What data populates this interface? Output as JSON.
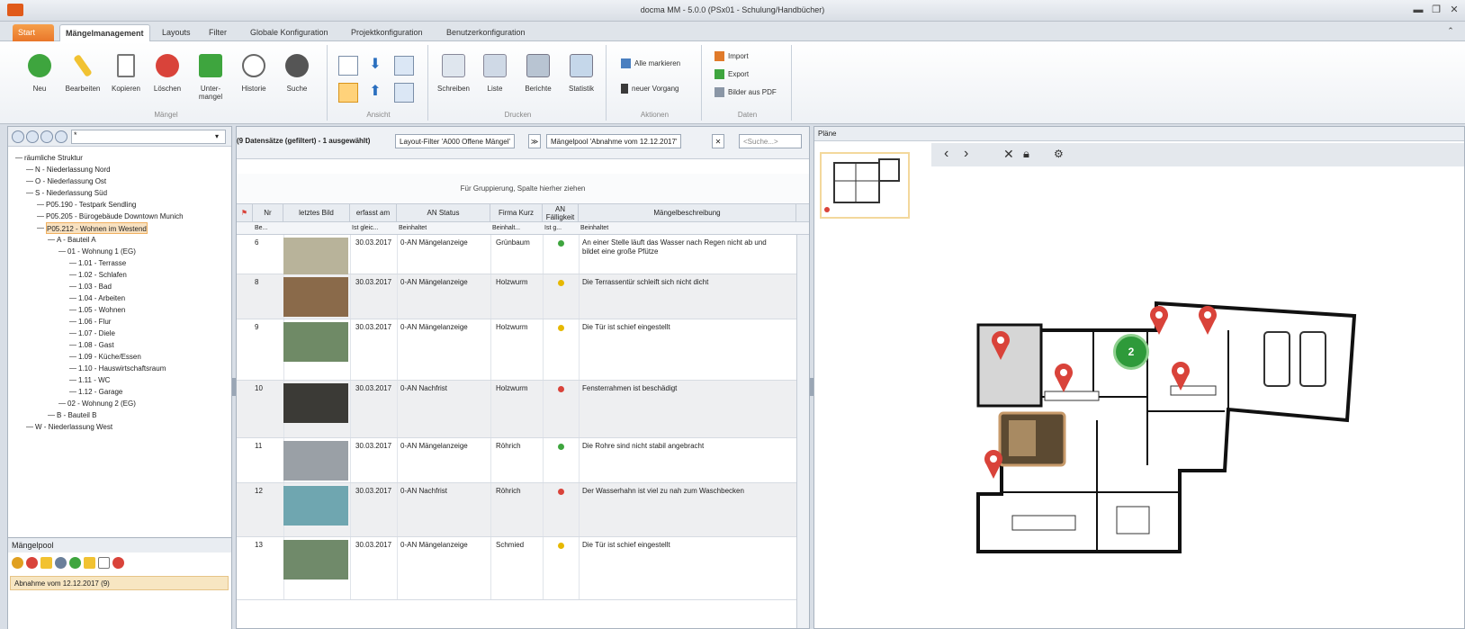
{
  "window": {
    "title": "docma MM - 5.0.0 (PSx01 - Schulung/Handbücher)"
  },
  "tabs": [
    "Start",
    "Mängelmanagement",
    "Layouts",
    "Filter",
    "Globale Konfiguration",
    "Projektkonfiguration",
    "Benutzerkonfiguration"
  ],
  "ribbon": {
    "maengel": {
      "buttons": [
        "Neu",
        "Bearbeiten",
        "Kopieren",
        "Löschen",
        "Unter-\nmangel",
        "Historie",
        "Suche"
      ],
      "label": "Mängel"
    },
    "ansicht": {
      "label": "Ansicht"
    },
    "drucken": {
      "buttons": [
        "Schreiben",
        "Liste",
        "Berichte",
        "Statistik"
      ],
      "label": "Drucken"
    },
    "aktionen": {
      "items": [
        "Alle markieren",
        "neuer Vorgang"
      ],
      "label": "Aktionen"
    },
    "daten": {
      "items": [
        "Import",
        "Export",
        "Bilder aus PDF"
      ],
      "label": "Daten"
    }
  },
  "left_toolbar": {
    "filter_value": "*"
  },
  "tree": [
    {
      "label": "räumliche Struktur",
      "level": 0
    },
    {
      "label": "N - Niederlassung Nord",
      "level": 1
    },
    {
      "label": "O - Niederlassung Ost",
      "level": 1
    },
    {
      "label": "S - Niederlassung Süd",
      "level": 1
    },
    {
      "label": "P05.190 - Testpark Sendling",
      "level": 2
    },
    {
      "label": "P05.205 - Bürogebäude Downtown Munich",
      "level": 2
    },
    {
      "label": "P05.212 - Wohnen im Westend",
      "level": 2,
      "selected": true
    },
    {
      "label": "A - Bauteil A",
      "level": 3
    },
    {
      "label": "01 - Wohnung 1 (EG)",
      "level": 4
    },
    {
      "label": "1.01 - Terrasse",
      "level": 5
    },
    {
      "label": "1.02 - Schlafen",
      "level": 5
    },
    {
      "label": "1.03 - Bad",
      "level": 5
    },
    {
      "label": "1.04 - Arbeiten",
      "level": 5
    },
    {
      "label": "1.05 - Wohnen",
      "level": 5
    },
    {
      "label": "1.06 - Flur",
      "level": 5
    },
    {
      "label": "1.07 - Diele",
      "level": 5
    },
    {
      "label": "1.08 - Gast",
      "level": 5
    },
    {
      "label": "1.09 - Küche/Essen",
      "level": 5
    },
    {
      "label": "1.10 - Hauswirtschaftsraum",
      "level": 5
    },
    {
      "label": "1.11 - WC",
      "level": 5
    },
    {
      "label": "1.12 - Garage",
      "level": 5
    },
    {
      "label": "02 - Wohnung 2 (EG)",
      "level": 4
    },
    {
      "label": "B - Bauteil B",
      "level": 3
    },
    {
      "label": "W - Niederlassung West",
      "level": 1
    }
  ],
  "maengelpool": {
    "title": "Mängelpool",
    "selected": "Abnahme vom 12.12.2017 (9)"
  },
  "middle": {
    "count": "(9 Datensätze (gefiltert) - 1 ausgewählt)",
    "layout_filter": "Layout-Filter 'A000 Offene Mängel'",
    "pool_filter": "Mängelpool 'Abnahme vom 12.12.2017'",
    "search_placeholder": "<Suche...>",
    "group_hint": "Für Gruppierung, Spalte hierher ziehen",
    "columns": [
      "Nr",
      "letztes Bild",
      "erfasst am",
      "AN Status",
      "Firma Kurz",
      "AN Fälligkeit",
      "Mängelbeschreibung"
    ],
    "filters": [
      "Be...",
      "Ist gleic...",
      "Beinhaltet",
      "Beinhalt...",
      "Ist g...",
      "Beinhaltet"
    ],
    "rows": [
      {
        "nr": "6",
        "date": "30.03.2017",
        "status": "0-AN Mängelanzeige",
        "firma": "Grünbaum",
        "due": "green",
        "desc": "An einer Stelle läuft das Wasser nach Regen nicht ab und\nbildet eine große Pfütze"
      },
      {
        "nr": "8",
        "date": "30.03.2017",
        "status": "0-AN Mängelanzeige",
        "firma": "Holzwurm",
        "due": "yellow",
        "desc": "Die Terrassentür schleift sich nicht dicht"
      },
      {
        "nr": "9",
        "date": "30.03.2017",
        "status": "0-AN Mängelanzeige",
        "firma": "Holzwurm",
        "due": "yellow",
        "desc": "Die Tür ist schief eingestellt"
      },
      {
        "nr": "10",
        "date": "30.03.2017",
        "status": "0-AN Nachfrist",
        "firma": "Holzwurm",
        "due": "red",
        "desc": "Fensterrahmen ist beschädigt"
      },
      {
        "nr": "11",
        "date": "30.03.2017",
        "status": "0-AN Mängelanzeige",
        "firma": "Röhrich",
        "due": "green",
        "desc": "Die Rohre sind nicht stabil angebracht"
      },
      {
        "nr": "12",
        "date": "30.03.2017",
        "status": "0-AN Nachfrist",
        "firma": "Röhrich",
        "due": "red",
        "desc": "Der Wasserhahn ist viel zu nah zum Waschbecken"
      },
      {
        "nr": "13",
        "date": "30.03.2017",
        "status": "0-AN Mängelanzeige",
        "firma": "Schmied",
        "due": "yellow",
        "desc": "Die Tür ist schief eingestellt"
      }
    ]
  },
  "right": {
    "title": "Pläne",
    "cluster_count": "2"
  },
  "colors": {
    "accent": "#e9762a",
    "pin": "#d9433a",
    "cluster": "#2e9a3a"
  }
}
